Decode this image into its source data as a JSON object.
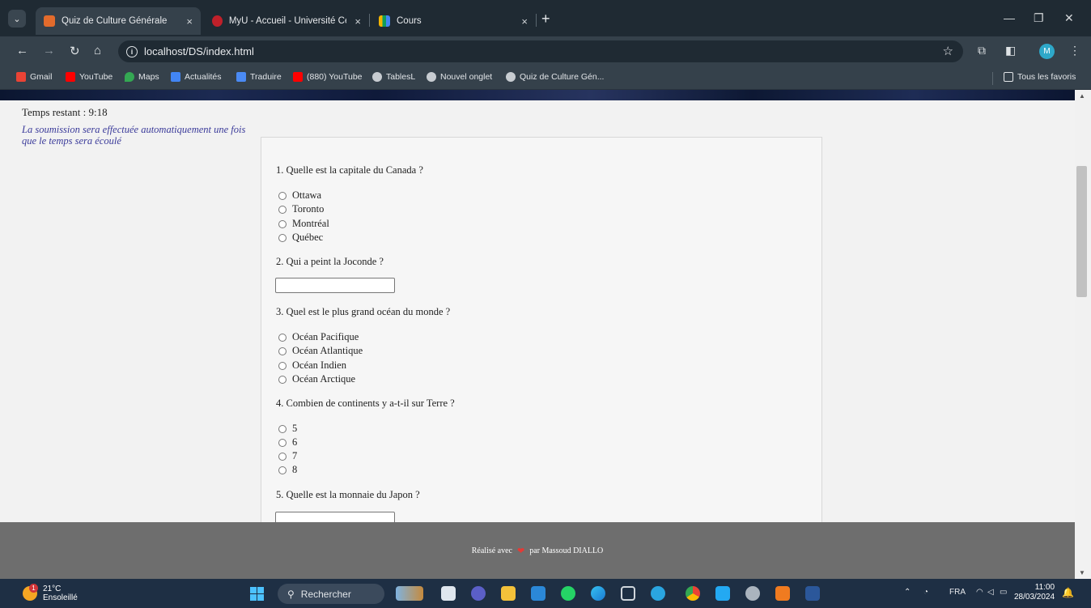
{
  "browser": {
    "tabs": [
      {
        "title": "Quiz de Culture Générale",
        "close": "×",
        "active": true
      },
      {
        "title": "MyU - Accueil - Université Cent",
        "close": "×",
        "active": false
      },
      {
        "title": "Cours",
        "close": "×",
        "active": false
      }
    ],
    "new_tab": "+",
    "url": "localhost/DS/index.html",
    "bookmarks": [
      "Gmail",
      "YouTube",
      "Maps",
      "Actualités",
      "Traduire",
      "(880) YouTube",
      "TablesL",
      "Nouvel onglet",
      "Quiz de Culture Gén..."
    ],
    "all_bookmarks": "Tous les favoris",
    "profile_initial": "M"
  },
  "page": {
    "timer": "Temps restant : 9:18",
    "notice": "La soumission sera effectuée automatiquement une fois que le temps sera écoulé",
    "questions": [
      {
        "text": "1. Quelle est la capitale du Canada ?",
        "options": [
          "Ottawa",
          "Toronto",
          "Montréal",
          "Québec"
        ]
      },
      {
        "text": "2. Qui a peint la Joconde ?"
      },
      {
        "text": "3. Quel est le plus grand océan du monde ?",
        "options": [
          "Océan Pacifique",
          "Océan Atlantique",
          "Océan Indien",
          "Océan Arctique"
        ]
      },
      {
        "text": "4. Combien de continents y a-t-il sur Terre ?",
        "options": [
          "5",
          "6",
          "7",
          "8"
        ]
      },
      {
        "text": "5. Quelle est la monnaie du Japon ?"
      }
    ],
    "footer_before": "Réalisé avec",
    "footer_after": "par Massoud DIALLO"
  },
  "taskbar": {
    "weather_temp": "21°C",
    "weather_desc": "Ensoleillé",
    "weather_badge": "1",
    "search": "Rechercher",
    "lang": "FRA",
    "time": "11:00",
    "date": "28/03/2024"
  },
  "colors": {
    "accent_link": "#3a3a9a",
    "footer_bg": "#6e6e6e",
    "chrome_bg": "#35414b"
  }
}
